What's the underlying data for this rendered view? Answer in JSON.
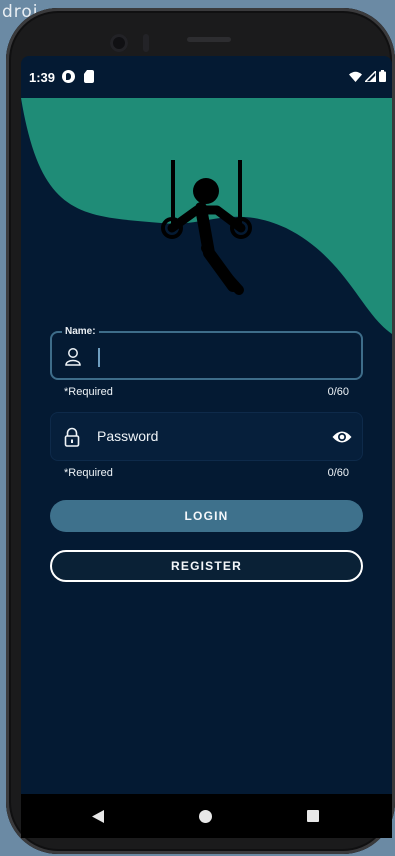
{
  "host": {
    "window_label_fragment": "droi"
  },
  "status_bar": {
    "time": "1:39",
    "icons": [
      "notification-p-icon",
      "sim-card-icon",
      "wifi-icon",
      "signal-icon",
      "battery-icon"
    ]
  },
  "theme": {
    "background": "#041a33",
    "accent_wave": "#1f8c77",
    "name_border": "#3e6d8a",
    "login_button": "#3e718c"
  },
  "hero": {
    "illustration": "gymnast-on-rings-icon"
  },
  "form": {
    "name": {
      "label": "Name:",
      "value": "",
      "helper": "*Required",
      "counter": "0/60",
      "icon": "person-icon"
    },
    "password": {
      "placeholder": "Password",
      "helper": "*Required",
      "counter": "0/60",
      "icon": "lock-icon",
      "toggle_icon": "eye-icon"
    }
  },
  "buttons": {
    "login": "LOGIN",
    "register": "REGISTER"
  },
  "navigation": {
    "back": "back-icon",
    "home": "home-icon",
    "recents": "recents-icon"
  }
}
